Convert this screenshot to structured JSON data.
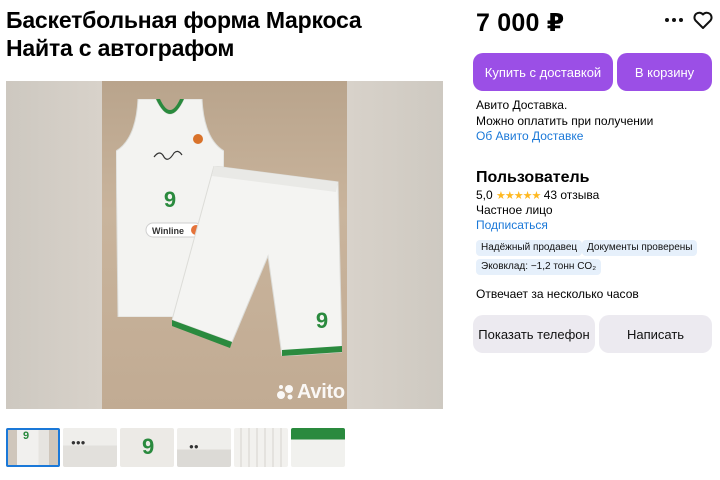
{
  "listing": {
    "title_line1": "Баскетбольная форма Маркоса",
    "title_line2": "Найта с автографом",
    "jersey_number": "9",
    "sponsor": "Winline",
    "watermark": "Avito"
  },
  "price": "7 000 ₽",
  "actions": {
    "buy_label": "Купить с доставкой",
    "cart_label": "В корзину",
    "phone_label": "Показать телефон",
    "write_label": "Написать"
  },
  "delivery": {
    "line1": "Авито Доставка.",
    "line2": "Можно оплатить при получении",
    "link": "Об Авито Доставке"
  },
  "seller": {
    "name": "Пользователь",
    "rating": "5,0",
    "stars": "★★★★★",
    "reviews": "43 отзыва",
    "type": "Частное лицо",
    "subscribe": "Подписаться",
    "badges": [
      "Надёжный продавец",
      "Документы проверены",
      "Эковклад: −1,2 тонн CO₂"
    ],
    "response": "Отвечает за несколько часов"
  },
  "colors": {
    "accent": "#9b4fe6",
    "link": "#1a78d8",
    "star": "#ffb921",
    "jersey_green": "#2a8a3e"
  },
  "icons": {
    "more": "more-dots-icon",
    "favorite": "heart-icon"
  }
}
